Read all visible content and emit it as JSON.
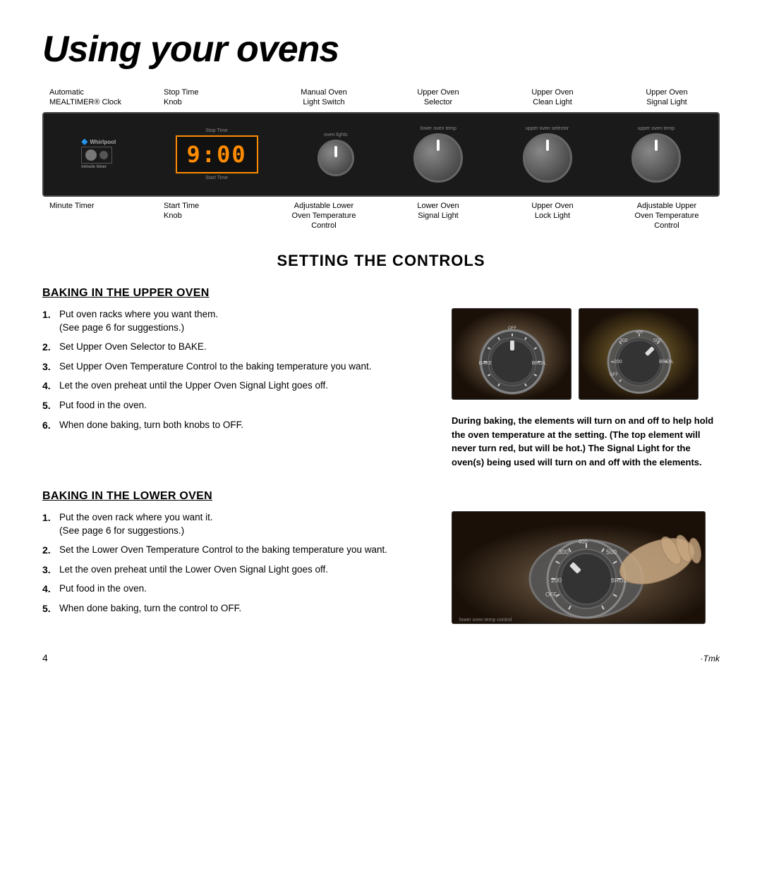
{
  "page": {
    "title": "Using your ovens",
    "page_number": "4",
    "trademark": "·Tmk"
  },
  "control_labels": {
    "top": [
      {
        "id": "automatic-mealtimer",
        "text": "Automatic\nMEALTIMER® Clock"
      },
      {
        "id": "stop-time-knob",
        "text": "Stop Time\nKnob"
      },
      {
        "id": "manual-oven-light",
        "text": "Manual Oven\nLight Switch"
      },
      {
        "id": "upper-oven-selector",
        "text": "Upper Oven\nSelector"
      },
      {
        "id": "upper-oven-clean-light",
        "text": "Upper Oven\nClean Light"
      },
      {
        "id": "upper-oven-signal-light-top",
        "text": "Upper Oven\nSignal Light"
      }
    ],
    "bottom": [
      {
        "id": "minute-timer",
        "text": "Minute Timer"
      },
      {
        "id": "start-time-knob",
        "text": "Start Time\nKnob"
      },
      {
        "id": "adjustable-lower-oven-temp",
        "text": "Adjustable Lower\nOven Temperature\nControl"
      },
      {
        "id": "lower-oven-signal-light",
        "text": "Lower Oven\nSignal Light"
      },
      {
        "id": "upper-oven-lock-light",
        "text": "Upper Oven\nLock Light"
      },
      {
        "id": "adjustable-upper-oven-temp",
        "text": "Adjustable Upper\nOven Temperature\nControl"
      }
    ]
  },
  "oven_panel": {
    "brand": "Whirlpool",
    "clock_display": "9:00",
    "labels": {
      "stop_time": "Stop Time",
      "start_time": "Start Time",
      "minute_timer": "minute timer",
      "oven_lights": "oven lights",
      "lower_oven_temp": "lower oven temp",
      "upper_oven_selector": "upper oven selector",
      "upper_oven_temp": "upper oven temp"
    }
  },
  "setting_controls": {
    "title": "SETTING THE CONTROLS"
  },
  "upper_oven_section": {
    "title": "BAKING IN THE UPPER OVEN",
    "steps": [
      {
        "num": "1.",
        "text": "Put oven racks where you want them. (See page 6 for suggestions.)"
      },
      {
        "num": "2.",
        "text": "Set Upper Oven Selector to BAKE."
      },
      {
        "num": "3.",
        "text": "Set Upper Oven Temperature Control to the baking temperature you want."
      },
      {
        "num": "4.",
        "text": "Let the oven preheat until the Upper Oven Signal Light goes off."
      },
      {
        "num": "5.",
        "text": "Put food in the oven."
      },
      {
        "num": "6.",
        "text": "When done baking, turn both knobs to OFF."
      }
    ],
    "bold_note": "During baking, the elements will turn on and off to help hold the oven temperature at the setting. (The top element will never turn red, but will be hot.) The Signal Light for the oven(s) being used will turn on and off with the elements."
  },
  "lower_oven_section": {
    "title": "BAKING IN THE LOWER OVEN",
    "steps": [
      {
        "num": "1.",
        "text": "Put the oven rack where you want it. (See page 6 for suggestions.)"
      },
      {
        "num": "2.",
        "text": "Set the Lower Oven Temperature Control to the baking temperature you want."
      },
      {
        "num": "3.",
        "text": "Let the oven preheat until the Lower Oven Signal Light goes off."
      },
      {
        "num": "4.",
        "text": "Put food in the oven."
      },
      {
        "num": "5.",
        "text": "When done baking, turn the control to OFF."
      }
    ]
  }
}
